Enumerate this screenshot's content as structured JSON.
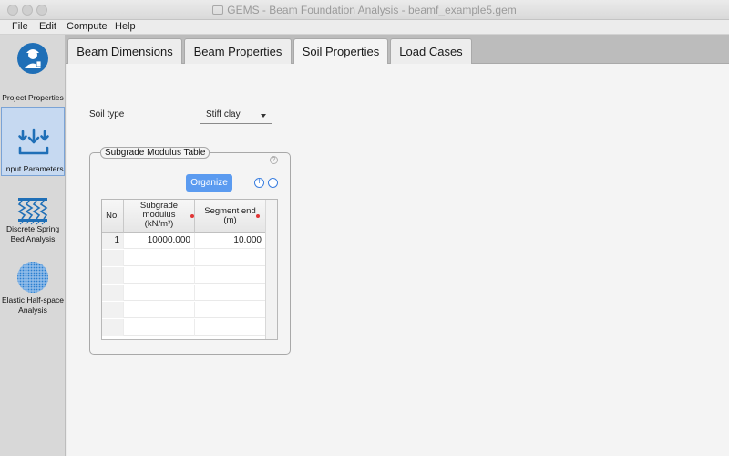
{
  "window": {
    "title": "GEMS - Beam Foundation Analysis - beamf_example5.gem"
  },
  "menu": [
    "File",
    "Edit",
    "Compute",
    "Help"
  ],
  "sidebar": {
    "items": [
      {
        "label": "Project Properties",
        "icon": "engineer-icon"
      },
      {
        "label": "Input Parameters",
        "icon": "input-arrows-icon",
        "active": true
      },
      {
        "label": "Discrete Spring Bed Analysis",
        "icon": "spring-bed-icon"
      },
      {
        "label": "Elastic Half-space Analysis",
        "icon": "half-space-icon"
      }
    ]
  },
  "tabs": [
    {
      "label": "Beam Dimensions"
    },
    {
      "label": "Beam Properties"
    },
    {
      "label": "Soil Properties",
      "active": true
    },
    {
      "label": "Load Cases"
    }
  ],
  "soil": {
    "label": "Soil type",
    "value": "Stiff clay"
  },
  "table_group": {
    "title": "Subgrade Modulus Table",
    "organize_label": "Organize",
    "add_symbol": "+",
    "remove_symbol": "−",
    "help_symbol": "?",
    "columns": [
      {
        "label": "No."
      },
      {
        "label": "Subgrade\nmodulus\n(kN/m³)",
        "required": true
      },
      {
        "label": "Segment end\n(m)",
        "required": true
      }
    ],
    "rows": [
      {
        "no": "1",
        "modulus": "10000.000",
        "segment_end": "10.000"
      }
    ]
  },
  "colors": {
    "accent": "#5b9bf0",
    "active_sidebar": "#c6d9f1",
    "required_marker": "#e03535"
  }
}
